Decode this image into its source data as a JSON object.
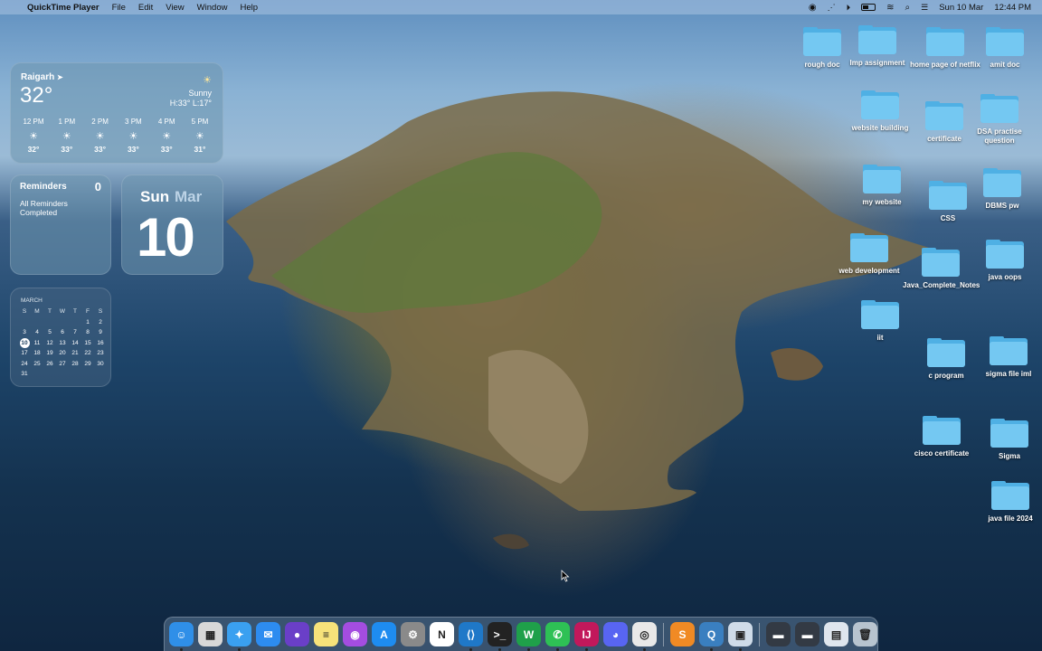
{
  "menubar": {
    "app_name": "QuickTime Player",
    "menus": [
      "File",
      "Edit",
      "View",
      "Window",
      "Help"
    ],
    "date": "Sun 10 Mar",
    "time": "12:44 PM",
    "status_icons": [
      "record-icon",
      "display-icon",
      "play-icon",
      "battery-icon",
      "wifi-icon",
      "search-icon",
      "control-center-icon"
    ]
  },
  "weather": {
    "city": "Raigarh",
    "temp": "32°",
    "condition": "Sunny",
    "hilo": "H:33° L:17°",
    "hours": [
      {
        "time": "12 PM",
        "temp": "32°"
      },
      {
        "time": "1 PM",
        "temp": "33°"
      },
      {
        "time": "2 PM",
        "temp": "33°"
      },
      {
        "time": "3 PM",
        "temp": "33°"
      },
      {
        "time": "4 PM",
        "temp": "33°"
      },
      {
        "time": "5 PM",
        "temp": "31°"
      }
    ]
  },
  "reminders": {
    "title": "Reminders",
    "count": "0",
    "status": "All Reminders Completed"
  },
  "date_widget": {
    "day": "Sun",
    "month": "Mar",
    "date": "10"
  },
  "calendar": {
    "month": "MARCH",
    "weekdays": [
      "S",
      "M",
      "T",
      "W",
      "T",
      "F",
      "S"
    ],
    "weeks": [
      [
        "",
        "",
        "",
        "",
        "",
        "1",
        "2"
      ],
      [
        "3",
        "4",
        "5",
        "6",
        "7",
        "8",
        "9"
      ],
      [
        "10",
        "11",
        "12",
        "13",
        "14",
        "15",
        "16"
      ],
      [
        "17",
        "18",
        "19",
        "20",
        "21",
        "22",
        "23"
      ],
      [
        "24",
        "25",
        "26",
        "27",
        "28",
        "29",
        "30"
      ],
      [
        "31",
        "",
        "",
        "",
        "",
        "",
        ""
      ]
    ],
    "today": "10"
  },
  "folders": [
    "rough doc",
    "Imp assignment",
    "home page of netflix",
    "amit doc",
    "website building",
    "certificate",
    "DSA practise question",
    "my website",
    "CSS",
    "DBMS pw",
    "web development",
    "Java_Complete_Notes",
    "java oops",
    "iit",
    "c program",
    "sigma file iml",
    "cisco certificate",
    "Sigma",
    "java file 2024"
  ],
  "dock": {
    "apps": [
      {
        "name": "finder",
        "glyph": "☺",
        "color": "#2f8fe8"
      },
      {
        "name": "launchpad",
        "glyph": "▦",
        "color": "#d8d8d8"
      },
      {
        "name": "safari",
        "glyph": "✦",
        "color": "#3aa0f0"
      },
      {
        "name": "mail",
        "glyph": "✉",
        "color": "#2d8cf0"
      },
      {
        "name": "siri",
        "glyph": "●",
        "color": "#6a3fc8"
      },
      {
        "name": "notes",
        "glyph": "≡",
        "color": "#f6e27a"
      },
      {
        "name": "podcasts",
        "glyph": "◉",
        "color": "#a44de0"
      },
      {
        "name": "app-store",
        "glyph": "A",
        "color": "#1e8cf0"
      },
      {
        "name": "system-settings",
        "glyph": "⚙",
        "color": "#8a8a8a"
      },
      {
        "name": "notion",
        "glyph": "N",
        "color": "#ffffff"
      },
      {
        "name": "vscode",
        "glyph": "⟨⟩",
        "color": "#1f78c8"
      },
      {
        "name": "terminal",
        "glyph": ">_",
        "color": "#222222"
      },
      {
        "name": "word",
        "glyph": "W",
        "color": "#1fa04a"
      },
      {
        "name": "whatsapp",
        "glyph": "✆",
        "color": "#2ec155"
      },
      {
        "name": "intellij",
        "glyph": "IJ",
        "color": "#c2185b"
      },
      {
        "name": "discord",
        "glyph": "◕",
        "color": "#5865f2"
      },
      {
        "name": "chrome",
        "glyph": "◎",
        "color": "#e8e8e8"
      },
      {
        "name": "sublime",
        "glyph": "S",
        "color": "#f08a24"
      },
      {
        "name": "quicktime",
        "glyph": "Q",
        "color": "#3a7fc0"
      },
      {
        "name": "preview",
        "glyph": "▣",
        "color": "#cfdbe8"
      },
      {
        "name": "recent-doc-1",
        "glyph": "▬",
        "color": "#333a44"
      },
      {
        "name": "recent-doc-2",
        "glyph": "▬",
        "color": "#333a44"
      },
      {
        "name": "downloads-stack",
        "glyph": "▤",
        "color": "#dfe6ee"
      },
      {
        "name": "trash",
        "glyph": "🗑",
        "color": "#b8c4cf"
      }
    ]
  }
}
